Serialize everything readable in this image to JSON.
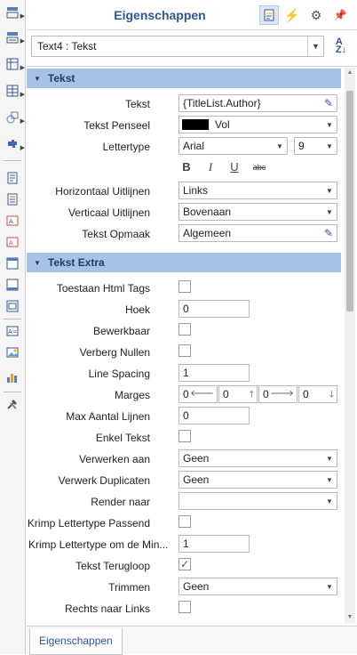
{
  "panel": {
    "title": "Eigenschappen",
    "selector_value": "Text4 : Tekst",
    "bottom_tab": "Eigenschappen"
  },
  "colors": {
    "accent": "#2f5597",
    "section_header": "#a8c1e6"
  },
  "sections": {
    "tekst": "Tekst",
    "tekst_extra": "Tekst Extra"
  },
  "tekst": {
    "tekst_label": "Tekst",
    "tekst_value": "{TitleList.Author}",
    "penseel_label": "Tekst Penseel",
    "penseel_value": "Vol",
    "lettertype_label": "Lettertype",
    "font_value": "Arial",
    "size_value": "9",
    "format_bold": "B",
    "format_italic": "I",
    "format_underline": "U",
    "format_strike": "abc",
    "horiz_label": "Horizontaal Uitlijnen",
    "horiz_value": "Links",
    "vert_label": "Verticaal Uitlijnen",
    "vert_value": "Bovenaan",
    "opmaak_label": "Tekst Opmaak",
    "opmaak_value": "Algemeen"
  },
  "extra": {
    "html_label": "Toestaan Html Tags",
    "hoek_label": "Hoek",
    "hoek_value": "0",
    "bewerk_label": "Bewerkbaar",
    "nullen_label": "Verberg Nullen",
    "spacing_label": "Line Spacing",
    "spacing_value": "1",
    "marges_label": "Marges",
    "marge_left": "0",
    "marge_top": "0",
    "marge_right": "0",
    "marge_bottom": "0",
    "max_lijnen_label": "Max Aantal Lijnen",
    "max_lijnen_value": "0",
    "enkel_label": "Enkel Tekst",
    "verwerken_label": "Verwerken aan",
    "verwerken_value": "Geen",
    "dup_label": "Verwerk Duplicaten",
    "dup_value": "Geen",
    "render_label": "Render naar",
    "render_value": "",
    "krimp_label": "Krimp Lettertype Passend",
    "krimp_min_label": "Krimp Lettertype om de Min...",
    "krimp_min_value": "1",
    "terugloop_label": "Tekst Terugloop",
    "terugloop_checked": true,
    "trimmen_label": "Trimmen",
    "trimmen_value": "Geen",
    "rtl_label": "Rechts naar Links"
  }
}
